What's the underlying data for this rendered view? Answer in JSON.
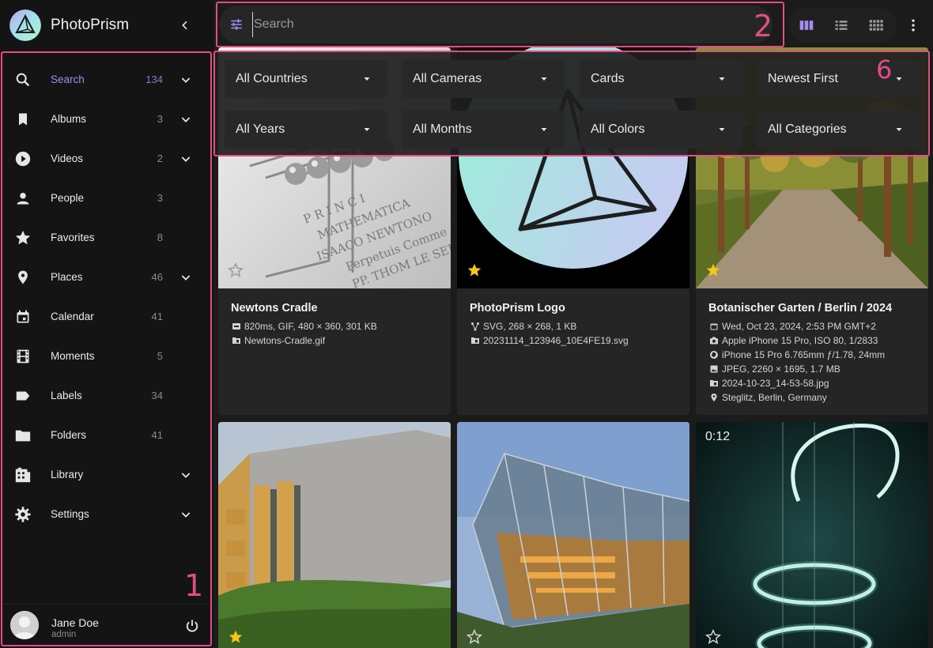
{
  "app": {
    "title": "PhotoPrism"
  },
  "sidebar": {
    "items": [
      {
        "label": "Search",
        "count": "134",
        "icon": "search-icon",
        "expandable": true,
        "active": true
      },
      {
        "label": "Albums",
        "count": "3",
        "icon": "bookmark-icon",
        "expandable": true
      },
      {
        "label": "Videos",
        "count": "2",
        "icon": "play-circle-icon",
        "expandable": true
      },
      {
        "label": "People",
        "count": "3",
        "icon": "person-icon",
        "expandable": false
      },
      {
        "label": "Favorites",
        "count": "8",
        "icon": "star-icon",
        "expandable": false
      },
      {
        "label": "Places",
        "count": "46",
        "icon": "map-pin-icon",
        "expandable": true
      },
      {
        "label": "Calendar",
        "count": "41",
        "icon": "calendar-icon",
        "expandable": false
      },
      {
        "label": "Moments",
        "count": "5",
        "icon": "film-icon",
        "expandable": false
      },
      {
        "label": "Labels",
        "count": "34",
        "icon": "label-icon",
        "expandable": false
      },
      {
        "label": "Folders",
        "count": "41",
        "icon": "folder-icon",
        "expandable": false
      },
      {
        "label": "Library",
        "count": "",
        "icon": "library-icon",
        "expandable": true
      },
      {
        "label": "Settings",
        "count": "",
        "icon": "gear-icon",
        "expandable": true
      }
    ],
    "user": {
      "name": "Jane Doe",
      "role": "admin"
    }
  },
  "search": {
    "placeholder": "Search",
    "value": ""
  },
  "view_modes": [
    "cards-view-icon",
    "list-view-icon",
    "mosaic-view-icon"
  ],
  "active_view": "cards",
  "filters": {
    "country": "All Countries",
    "camera": "All Cameras",
    "view": "Cards",
    "sort": "Newest First",
    "year": "All Years",
    "month": "All Months",
    "color": "All Colors",
    "category": "All Categories"
  },
  "annotations": {
    "sidebar": "1",
    "search": "2",
    "filters": "6"
  },
  "cards": [
    {
      "title": "Newtons Cradle",
      "favorite": false,
      "meta": [
        {
          "icon": "gif-icon",
          "text": "820ms, GIF, 480 × 360, 301 KB"
        },
        {
          "icon": "file-icon",
          "text": "Newtons-Cradle.gif"
        }
      ]
    },
    {
      "title": "PhotoPrism Logo",
      "favorite": true,
      "meta": [
        {
          "icon": "vector-icon",
          "text": "SVG, 268 × 268, 1 KB"
        },
        {
          "icon": "file-icon",
          "text": "20231114_123946_10E4FE19.svg"
        }
      ]
    },
    {
      "title": "Botanischer Garten / Berlin / 2024",
      "favorite": true,
      "meta": [
        {
          "icon": "calendar-icon",
          "text": "Wed, Oct 23, 2024, 2:53 PM GMT+2"
        },
        {
          "icon": "camera-icon",
          "text": "Apple iPhone 15 Pro, ISO 80, 1/2833"
        },
        {
          "icon": "aperture-icon",
          "text": "iPhone 15 Pro 6.765mm ƒ/1.78, 24mm"
        },
        {
          "icon": "image-icon",
          "text": "JPEG, 2260 × 1695, 1.7 MB"
        },
        {
          "icon": "file-icon",
          "text": "2024-10-23_14-53-58.jpg"
        },
        {
          "icon": "map-pin-icon",
          "text": "Steglitz, Berlin, Germany"
        }
      ]
    },
    {
      "title": "",
      "favorite": true,
      "meta": []
    },
    {
      "title": "",
      "favorite": false,
      "meta": []
    },
    {
      "title": "",
      "favorite": false,
      "duration": "0:12",
      "meta": []
    }
  ],
  "colors": {
    "accent": "#a48cf0",
    "annotation": "#e34c86",
    "star_active": "#f5c518"
  }
}
